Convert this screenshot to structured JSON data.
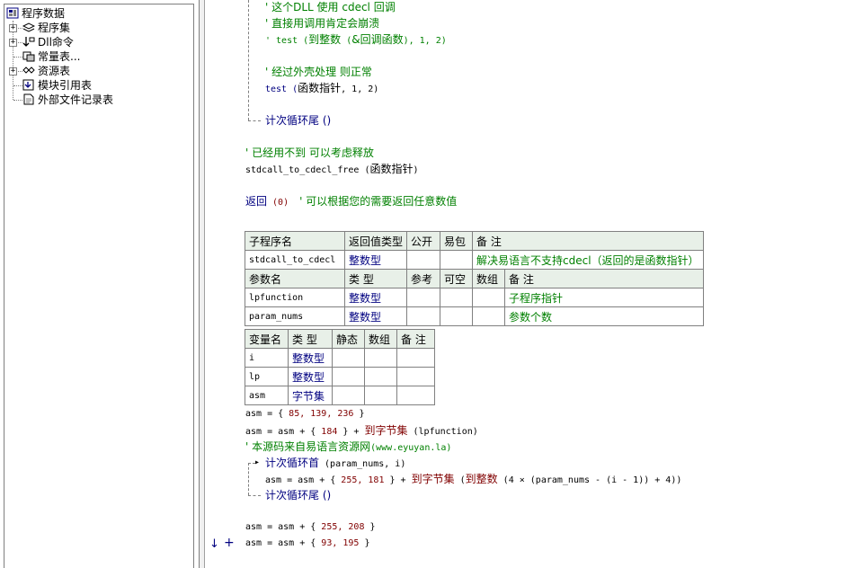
{
  "tree": {
    "root": "程序数据",
    "items": [
      {
        "label": "程序集",
        "expandable": true
      },
      {
        "label": "Dll命令",
        "expandable": true
      },
      {
        "label": "常量表...",
        "expandable": false
      },
      {
        "label": "资源表",
        "expandable": true
      },
      {
        "label": "模块引用表",
        "expandable": false
      },
      {
        "label": "外部文件记录表",
        "expandable": false
      }
    ]
  },
  "code": {
    "c1": "' 这个DLL 使用 cdecl 回调",
    "c2": "' 直接用调用肯定会崩溃",
    "c3a": "' test (",
    "c3b": "到整数",
    "c3c": " (",
    "c3d": "&回调函数",
    "c3e": "), 1, 2)",
    "c4": "' 经过外壳处理 则正常",
    "c5a": "test (",
    "c5b": "函数指针",
    "c5c": ", 1, 2)",
    "loop_end1": "计次循环尾 ()",
    "c6": "' 已经用不到 可以考虑释放",
    "c7a": "stdcall_to_cdecl_free (",
    "c7b": "函数指针",
    "c7c": ")",
    "ret_a": "返回",
    "ret_b": " (0)  ",
    "ret_c": "' 可以根据您的需要返回任意数值"
  },
  "sub_table": {
    "headers": [
      "子程序名",
      "返回值类型",
      "公开",
      "易包",
      "备 注"
    ],
    "name": "stdcall_to_cdecl",
    "ret_type": "整数型",
    "note": "解决易语言不支持cdecl（返回的是函数指针）",
    "param_headers": [
      "参数名",
      "类 型",
      "参考",
      "可空",
      "数组",
      "备 注"
    ],
    "params": [
      {
        "name": "lpfunction",
        "type": "整数型",
        "note": "子程序指针"
      },
      {
        "name": "param_nums",
        "type": "整数型",
        "note": "参数个数"
      }
    ]
  },
  "var_table": {
    "headers": [
      "变量名",
      "类 型",
      "静态",
      "数组",
      "备 注"
    ],
    "vars": [
      {
        "name": "i",
        "type": "整数型"
      },
      {
        "name": "lp",
        "type": "整数型"
      },
      {
        "name": "asm",
        "type": "字节集"
      }
    ]
  },
  "code2": {
    "l1a": "asm = { ",
    "l1b": "85, 139, 236",
    "l1c": " }",
    "l2a": "asm = asm + { ",
    "l2b": "184",
    "l2c": " } + ",
    "l2d": "到字节集",
    "l2e": " (lpfunction)",
    "l3a": "' 本源码来自易语言资源网",
    "l3b": "(www.eyuyan.la)",
    "loop_head_a": "计次循环首",
    "loop_head_b": " (param_nums, i)",
    "l4a": "asm = asm + { ",
    "l4b": "255, 181",
    "l4c": " } + ",
    "l4d": "到字节集",
    "l4e": " (",
    "l4f": "到整数",
    "l4g": " (4 × (param_nums - (i - 1)) + 4))",
    "loop_end2": "计次循环尾 ()",
    "l5a": "asm = asm + { ",
    "l5b": "255, 208",
    "l5c": " }",
    "l6a": "asm = asm + { ",
    "l6b": "93, 195",
    "l6c": " }"
  }
}
